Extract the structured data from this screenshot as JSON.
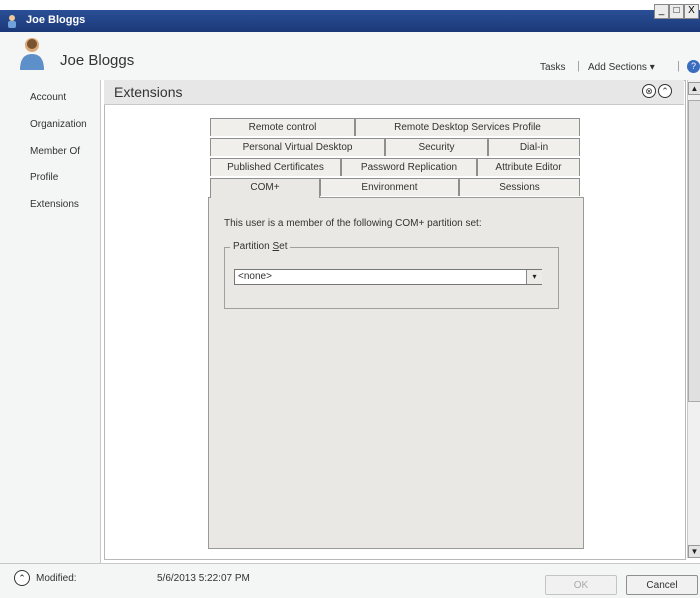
{
  "window": {
    "title": "Joe Bloggs",
    "minimize": "_",
    "maximize": "□",
    "close": "X"
  },
  "header": {
    "user_name": "Joe Bloggs",
    "tasks_label": "Tasks",
    "add_sections_label": "Add Sections ▾",
    "separator": "|",
    "help_icon": "?"
  },
  "nav": {
    "items": [
      {
        "label": "Account"
      },
      {
        "label": "Organization"
      },
      {
        "label": "Member Of"
      },
      {
        "label": "Profile"
      },
      {
        "label": "Extensions"
      }
    ]
  },
  "section": {
    "title": "Extensions",
    "close_glyph": "⊗",
    "collapse_glyph": "⌃"
  },
  "tabs": {
    "row1": [
      "Remote control",
      "Remote Desktop Services Profile"
    ],
    "row2": [
      "Personal Virtual Desktop",
      "Security",
      "Dial-in"
    ],
    "row3": [
      "Published Certificates",
      "Password Replication",
      "Attribute Editor"
    ],
    "row4": [
      "COM+",
      "Environment",
      "Sessions"
    ],
    "active": "COM+"
  },
  "complus": {
    "description": "This user is a member of the following COM+ partition set:",
    "group_label_pre": "Partition ",
    "group_label_ul": "S",
    "group_label_post": "et",
    "select_value": "<none>",
    "select_arrow": "▾"
  },
  "footer": {
    "modified_icon": "⌃",
    "modified_label": "Modified:",
    "modified_date": "5/6/2013 5:22:07 PM",
    "ok_label": "OK",
    "cancel_label": "Cancel"
  },
  "colors": {
    "titlebar": "#1b3878",
    "dialog": "#e9e8e4"
  },
  "icons": [
    "user-avatar-icon",
    "help-icon",
    "close-circle-icon",
    "collapse-circle-icon",
    "dropdown-arrow-icon"
  ]
}
